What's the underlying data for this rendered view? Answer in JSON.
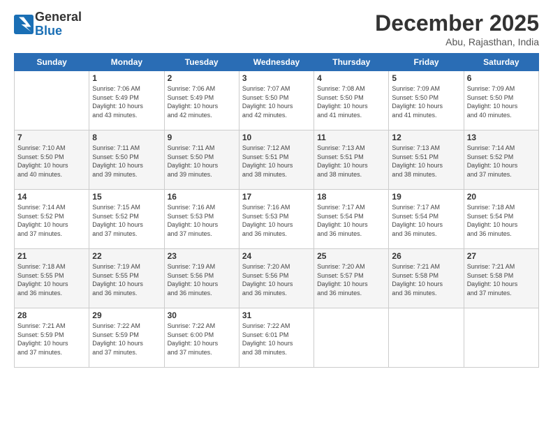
{
  "header": {
    "logo_general": "General",
    "logo_blue": "Blue",
    "title": "December 2025",
    "subtitle": "Abu, Rajasthan, India"
  },
  "weekdays": [
    "Sunday",
    "Monday",
    "Tuesday",
    "Wednesday",
    "Thursday",
    "Friday",
    "Saturday"
  ],
  "weeks": [
    [
      {
        "date": "",
        "info": ""
      },
      {
        "date": "1",
        "info": "Sunrise: 7:06 AM\nSunset: 5:49 PM\nDaylight: 10 hours\nand 43 minutes."
      },
      {
        "date": "2",
        "info": "Sunrise: 7:06 AM\nSunset: 5:49 PM\nDaylight: 10 hours\nand 42 minutes."
      },
      {
        "date": "3",
        "info": "Sunrise: 7:07 AM\nSunset: 5:50 PM\nDaylight: 10 hours\nand 42 minutes."
      },
      {
        "date": "4",
        "info": "Sunrise: 7:08 AM\nSunset: 5:50 PM\nDaylight: 10 hours\nand 41 minutes."
      },
      {
        "date": "5",
        "info": "Sunrise: 7:09 AM\nSunset: 5:50 PM\nDaylight: 10 hours\nand 41 minutes."
      },
      {
        "date": "6",
        "info": "Sunrise: 7:09 AM\nSunset: 5:50 PM\nDaylight: 10 hours\nand 40 minutes."
      }
    ],
    [
      {
        "date": "7",
        "info": "Sunrise: 7:10 AM\nSunset: 5:50 PM\nDaylight: 10 hours\nand 40 minutes."
      },
      {
        "date": "8",
        "info": "Sunrise: 7:11 AM\nSunset: 5:50 PM\nDaylight: 10 hours\nand 39 minutes."
      },
      {
        "date": "9",
        "info": "Sunrise: 7:11 AM\nSunset: 5:50 PM\nDaylight: 10 hours\nand 39 minutes."
      },
      {
        "date": "10",
        "info": "Sunrise: 7:12 AM\nSunset: 5:51 PM\nDaylight: 10 hours\nand 38 minutes."
      },
      {
        "date": "11",
        "info": "Sunrise: 7:13 AM\nSunset: 5:51 PM\nDaylight: 10 hours\nand 38 minutes."
      },
      {
        "date": "12",
        "info": "Sunrise: 7:13 AM\nSunset: 5:51 PM\nDaylight: 10 hours\nand 38 minutes."
      },
      {
        "date": "13",
        "info": "Sunrise: 7:14 AM\nSunset: 5:52 PM\nDaylight: 10 hours\nand 37 minutes."
      }
    ],
    [
      {
        "date": "14",
        "info": "Sunrise: 7:14 AM\nSunset: 5:52 PM\nDaylight: 10 hours\nand 37 minutes."
      },
      {
        "date": "15",
        "info": "Sunrise: 7:15 AM\nSunset: 5:52 PM\nDaylight: 10 hours\nand 37 minutes."
      },
      {
        "date": "16",
        "info": "Sunrise: 7:16 AM\nSunset: 5:53 PM\nDaylight: 10 hours\nand 37 minutes."
      },
      {
        "date": "17",
        "info": "Sunrise: 7:16 AM\nSunset: 5:53 PM\nDaylight: 10 hours\nand 36 minutes."
      },
      {
        "date": "18",
        "info": "Sunrise: 7:17 AM\nSunset: 5:54 PM\nDaylight: 10 hours\nand 36 minutes."
      },
      {
        "date": "19",
        "info": "Sunrise: 7:17 AM\nSunset: 5:54 PM\nDaylight: 10 hours\nand 36 minutes."
      },
      {
        "date": "20",
        "info": "Sunrise: 7:18 AM\nSunset: 5:54 PM\nDaylight: 10 hours\nand 36 minutes."
      }
    ],
    [
      {
        "date": "21",
        "info": "Sunrise: 7:18 AM\nSunset: 5:55 PM\nDaylight: 10 hours\nand 36 minutes."
      },
      {
        "date": "22",
        "info": "Sunrise: 7:19 AM\nSunset: 5:55 PM\nDaylight: 10 hours\nand 36 minutes."
      },
      {
        "date": "23",
        "info": "Sunrise: 7:19 AM\nSunset: 5:56 PM\nDaylight: 10 hours\nand 36 minutes."
      },
      {
        "date": "24",
        "info": "Sunrise: 7:20 AM\nSunset: 5:56 PM\nDaylight: 10 hours\nand 36 minutes."
      },
      {
        "date": "25",
        "info": "Sunrise: 7:20 AM\nSunset: 5:57 PM\nDaylight: 10 hours\nand 36 minutes."
      },
      {
        "date": "26",
        "info": "Sunrise: 7:21 AM\nSunset: 5:58 PM\nDaylight: 10 hours\nand 36 minutes."
      },
      {
        "date": "27",
        "info": "Sunrise: 7:21 AM\nSunset: 5:58 PM\nDaylight: 10 hours\nand 37 minutes."
      }
    ],
    [
      {
        "date": "28",
        "info": "Sunrise: 7:21 AM\nSunset: 5:59 PM\nDaylight: 10 hours\nand 37 minutes."
      },
      {
        "date": "29",
        "info": "Sunrise: 7:22 AM\nSunset: 5:59 PM\nDaylight: 10 hours\nand 37 minutes."
      },
      {
        "date": "30",
        "info": "Sunrise: 7:22 AM\nSunset: 6:00 PM\nDaylight: 10 hours\nand 37 minutes."
      },
      {
        "date": "31",
        "info": "Sunrise: 7:22 AM\nSunset: 6:01 PM\nDaylight: 10 hours\nand 38 minutes."
      },
      {
        "date": "",
        "info": ""
      },
      {
        "date": "",
        "info": ""
      },
      {
        "date": "",
        "info": ""
      }
    ]
  ]
}
